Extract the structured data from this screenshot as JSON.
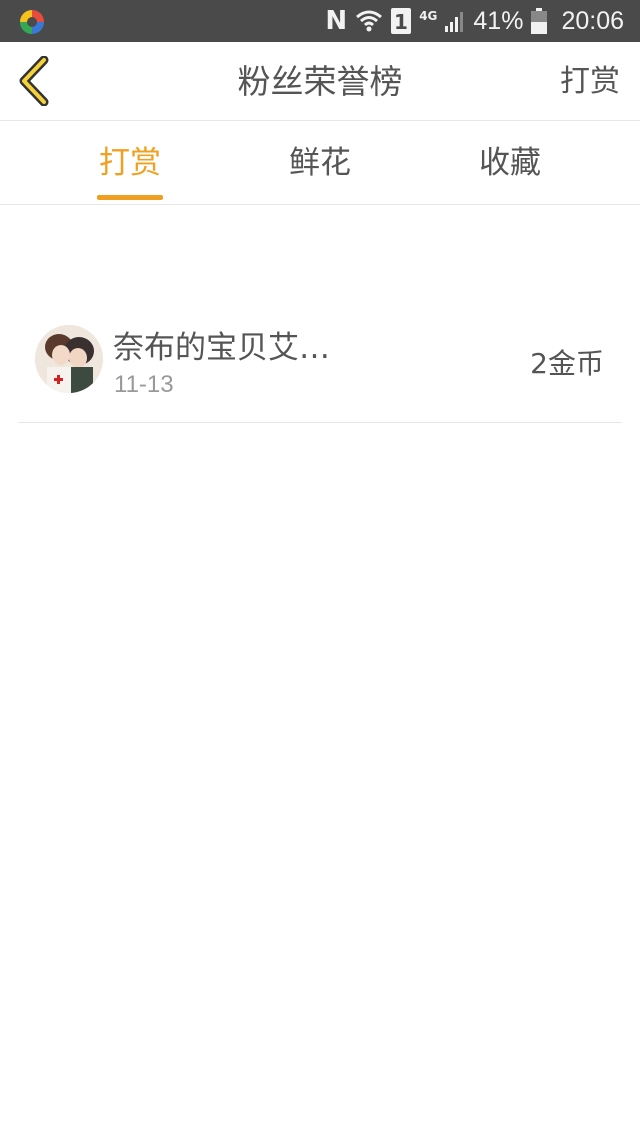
{
  "status_bar": {
    "n_icon": "N",
    "sim_label": "1",
    "network": "4G",
    "battery": "41%",
    "time": "20:06"
  },
  "header": {
    "title": "粉丝荣誉榜",
    "right_action": "打赏"
  },
  "tabs": [
    {
      "label": "打赏",
      "active": true
    },
    {
      "label": "鲜花",
      "active": false
    },
    {
      "label": "收藏",
      "active": false
    }
  ],
  "list": [
    {
      "name": "奈布的宝贝艾…",
      "date": "11-13",
      "amount": "2金币"
    }
  ],
  "colors": {
    "accent": "#f0a020",
    "status_bar_bg": "#4a4a4a",
    "text": "#555555",
    "secondary_text": "#999999",
    "divider": "#e6e6e6"
  }
}
